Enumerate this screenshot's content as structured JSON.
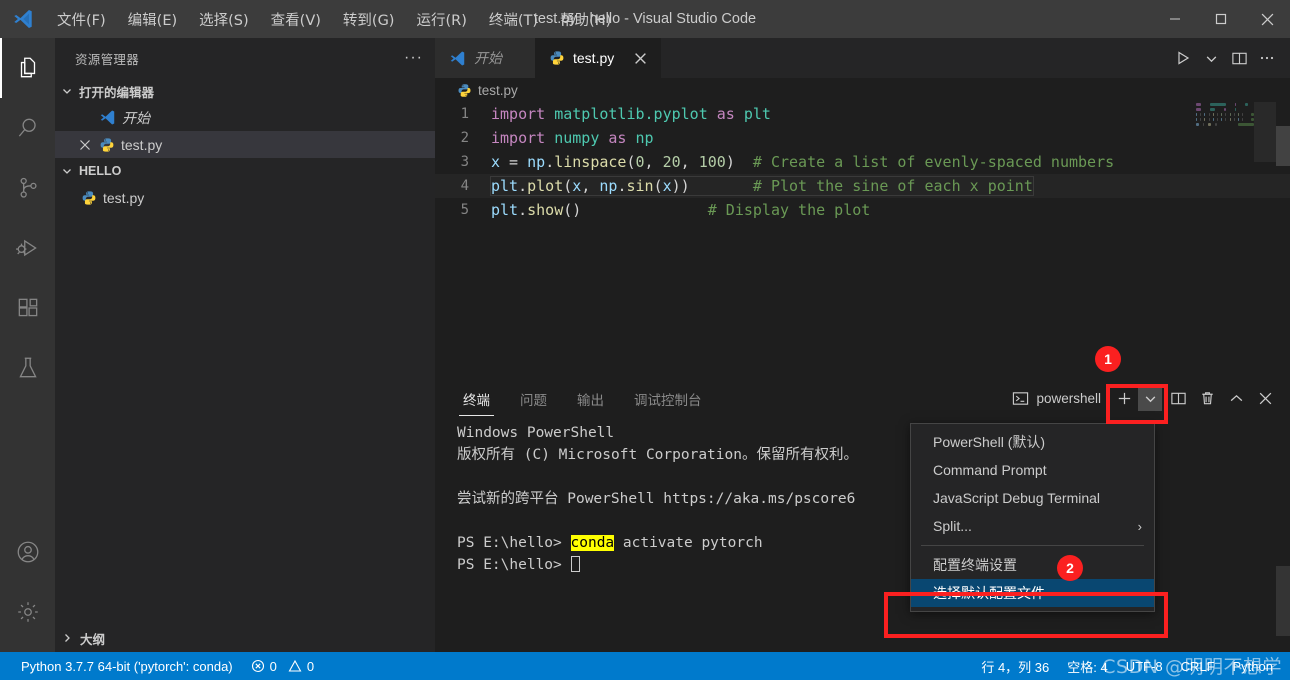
{
  "titlebar": {
    "logo_icon": "vscode-logo-icon",
    "menus": [
      {
        "label": "文件(F)",
        "mnemonic": "F"
      },
      {
        "label": "编辑(E)",
        "mnemonic": "E"
      },
      {
        "label": "选择(S)",
        "mnemonic": "S"
      },
      {
        "label": "查看(V)",
        "mnemonic": "V"
      },
      {
        "label": "转到(G)",
        "mnemonic": "G"
      },
      {
        "label": "运行(R)",
        "mnemonic": "R"
      },
      {
        "label": "终端(T)",
        "mnemonic": "T"
      },
      {
        "label": "帮助(H)",
        "mnemonic": "H"
      }
    ],
    "window_title": "test.py - hello - Visual Studio Code",
    "minimize_label": "—",
    "maximize_label": "□",
    "close_label": "✕"
  },
  "activitybar": {
    "items": [
      {
        "name": "explorer",
        "icon": "files-icon",
        "active": true
      },
      {
        "name": "search",
        "icon": "search-icon",
        "active": false
      },
      {
        "name": "source-control",
        "icon": "source-control-icon",
        "active": false
      },
      {
        "name": "run-debug",
        "icon": "run-debug-icon",
        "active": false
      },
      {
        "name": "extensions",
        "icon": "extensions-icon",
        "active": false
      },
      {
        "name": "testing",
        "icon": "beaker-icon",
        "active": false
      }
    ],
    "bottom_items": [
      {
        "name": "accounts",
        "icon": "account-icon"
      },
      {
        "name": "manage",
        "icon": "gear-icon"
      }
    ]
  },
  "sidebar": {
    "title": "资源管理器",
    "more_actions": "···",
    "open_editors": {
      "label": "打开的编辑器",
      "expanded": true,
      "items": [
        {
          "label": "开始",
          "icon": "vscode-logo-icon",
          "italic": true,
          "selected": false,
          "closable": false
        },
        {
          "label": "test.py",
          "icon": "python-icon",
          "italic": false,
          "selected": true,
          "closable": true
        }
      ]
    },
    "folder": {
      "label": "HELLO",
      "expanded": true,
      "items": [
        {
          "label": "test.py",
          "icon": "python-icon",
          "selected": false
        }
      ]
    },
    "outline": {
      "label": "大纲",
      "expanded": false
    }
  },
  "editor": {
    "tabs": [
      {
        "label": "开始",
        "icon": "vscode-logo-icon",
        "active": false,
        "italic": true,
        "closable": false
      },
      {
        "label": "test.py",
        "icon": "python-icon",
        "active": true,
        "italic": false,
        "closable": true,
        "close_label": "✕"
      }
    ],
    "actions": [
      {
        "name": "run-python-file",
        "icon": "play-icon"
      },
      {
        "name": "run-dropdown",
        "icon": "chevron-down-icon"
      },
      {
        "name": "split-editor",
        "icon": "split-editor-icon"
      },
      {
        "name": "more-actions",
        "icon": "ellipsis-icon"
      }
    ],
    "breadcrumb": [
      {
        "label": "test.py",
        "icon": "python-icon"
      }
    ],
    "cursor_line": 4,
    "lines": [
      {
        "num": "1",
        "tokens": [
          {
            "t": "import",
            "c": "kw"
          },
          {
            "t": " ",
            "c": "op"
          },
          {
            "t": "matplotlib.pyplot",
            "c": "mod"
          },
          {
            "t": " ",
            "c": "op"
          },
          {
            "t": "as",
            "c": "kw"
          },
          {
            "t": " ",
            "c": "op"
          },
          {
            "t": "plt",
            "c": "mod"
          }
        ]
      },
      {
        "num": "2",
        "tokens": [
          {
            "t": "import",
            "c": "kw"
          },
          {
            "t": " ",
            "c": "op"
          },
          {
            "t": "numpy",
            "c": "mod"
          },
          {
            "t": " ",
            "c": "op"
          },
          {
            "t": "as",
            "c": "kw"
          },
          {
            "t": " ",
            "c": "op"
          },
          {
            "t": "np",
            "c": "mod"
          }
        ]
      },
      {
        "num": "3",
        "tokens": [
          {
            "t": "x",
            "c": "id"
          },
          {
            "t": " = ",
            "c": "op"
          },
          {
            "t": "np",
            "c": "id"
          },
          {
            "t": ".",
            "c": "punct"
          },
          {
            "t": "linspace",
            "c": "fn"
          },
          {
            "t": "(",
            "c": "punct"
          },
          {
            "t": "0",
            "c": "num"
          },
          {
            "t": ", ",
            "c": "punct"
          },
          {
            "t": "20",
            "c": "num"
          },
          {
            "t": ", ",
            "c": "punct"
          },
          {
            "t": "100",
            "c": "num"
          },
          {
            "t": ")",
            "c": "punct"
          },
          {
            "t": "  ",
            "c": "op"
          },
          {
            "t": "# Create a list of evenly-spaced numbers",
            "c": "com"
          }
        ]
      },
      {
        "num": "4",
        "tokens": [
          {
            "t": "plt",
            "c": "id"
          },
          {
            "t": ".",
            "c": "punct"
          },
          {
            "t": "plot",
            "c": "fn"
          },
          {
            "t": "(",
            "c": "punct"
          },
          {
            "t": "x",
            "c": "id"
          },
          {
            "t": ", ",
            "c": "punct"
          },
          {
            "t": "np",
            "c": "id"
          },
          {
            "t": ".",
            "c": "punct"
          },
          {
            "t": "sin",
            "c": "fn"
          },
          {
            "t": "(",
            "c": "punct"
          },
          {
            "t": "x",
            "c": "id"
          },
          {
            "t": "))",
            "c": "punct"
          },
          {
            "t": "       ",
            "c": "op"
          },
          {
            "t": "# Plot the sine of each x point",
            "c": "com"
          }
        ]
      },
      {
        "num": "5",
        "tokens": [
          {
            "t": "plt",
            "c": "id"
          },
          {
            "t": ".",
            "c": "punct"
          },
          {
            "t": "show",
            "c": "fn"
          },
          {
            "t": "()",
            "c": "punct"
          },
          {
            "t": "              ",
            "c": "op"
          },
          {
            "t": "# Display the plot",
            "c": "com"
          }
        ]
      }
    ]
  },
  "panel": {
    "tabs": [
      {
        "label": "终端",
        "active": true
      },
      {
        "label": "问题",
        "active": false
      },
      {
        "label": "输出",
        "active": false
      },
      {
        "label": "调试控制台",
        "active": false
      }
    ],
    "terminal_selector": {
      "label": "powershell",
      "icon": "terminal-icon"
    },
    "actions": [
      {
        "name": "new-terminal",
        "icon": "plus-icon",
        "label": "+"
      },
      {
        "name": "terminal-profile-dropdown",
        "icon": "chevron-down-icon"
      },
      {
        "name": "split-terminal",
        "icon": "split-terminal-icon"
      },
      {
        "name": "kill-terminal",
        "icon": "trash-icon"
      },
      {
        "name": "maximize-panel",
        "icon": "chevron-up-icon"
      },
      {
        "name": "close-panel",
        "icon": "close-icon"
      }
    ],
    "terminal_lines": [
      [
        {
          "t": "Windows PowerShell",
          "c": "plain"
        }
      ],
      [
        {
          "t": "版权所有 (C) Microsoft Corporation。保留所有权利。",
          "c": "plain"
        }
      ],
      [
        {
          "t": "",
          "c": "plain"
        }
      ],
      [
        {
          "t": "尝试新的跨平台 PowerShell https://aka.ms/pscore6",
          "c": "plain"
        }
      ],
      [
        {
          "t": "",
          "c": "plain"
        }
      ],
      [
        {
          "t": "PS E:\\hello> ",
          "c": "plain"
        },
        {
          "t": "conda",
          "c": "hl"
        },
        {
          "t": " activate pytorch",
          "c": "plain"
        }
      ],
      [
        {
          "t": "PS E:\\hello> ",
          "c": "plain"
        },
        {
          "t": "▊",
          "c": "caret"
        }
      ]
    ]
  },
  "context_menu": {
    "items": [
      {
        "label": "PowerShell (默认)",
        "selected": false,
        "submenu": false,
        "separator_after": false
      },
      {
        "label": "Command Prompt",
        "selected": false,
        "submenu": false,
        "separator_after": false
      },
      {
        "label": "JavaScript Debug Terminal",
        "selected": false,
        "submenu": false,
        "separator_after": false
      },
      {
        "label": "Split...",
        "selected": false,
        "submenu": true,
        "submenu_arrow": "›",
        "separator_after": true
      },
      {
        "label": "配置终端设置",
        "selected": false,
        "submenu": false,
        "separator_after": false
      },
      {
        "label": "选择默认配置文件",
        "selected": true,
        "submenu": false,
        "separator_after": false
      }
    ]
  },
  "annotations": {
    "badge_1": "1",
    "badge_2": "2",
    "color": "#fb2020"
  },
  "statusbar": {
    "left": [
      {
        "name": "python-interpreter",
        "label": "Python 3.7.7 64-bit ('pytorch': conda)",
        "icon": null
      },
      {
        "name": "problems",
        "label": "0",
        "icon": "error-icon",
        "label2": "0",
        "icon2": "warning-icon"
      }
    ],
    "errors_count": "0",
    "warnings_count": "0",
    "right": [
      {
        "name": "cursor-position",
        "label": "行 4，列 36"
      },
      {
        "name": "indentation",
        "label": "空格: 4"
      },
      {
        "name": "encoding",
        "label": "UTF-8"
      },
      {
        "name": "eol",
        "label": "CRLF"
      },
      {
        "name": "language-mode",
        "label": "Python"
      }
    ],
    "watermark": "CSDN @明明不想学",
    "background": "#007acc"
  }
}
